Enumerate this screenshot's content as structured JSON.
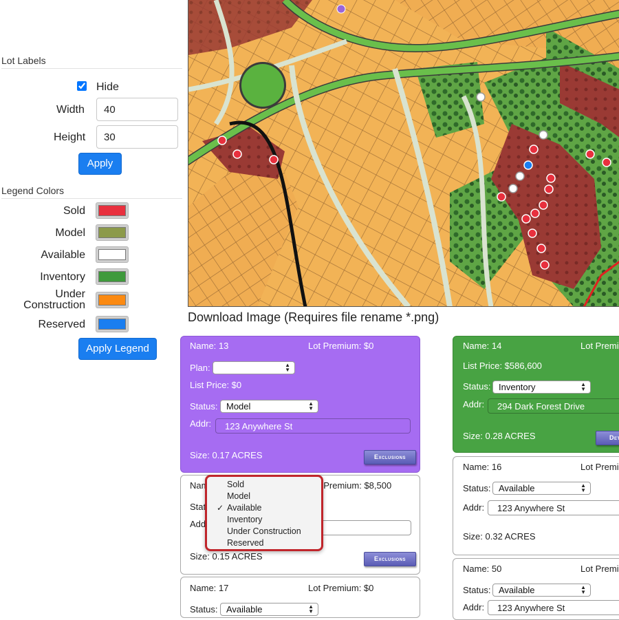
{
  "lot_labels": {
    "title": "Lot Labels",
    "hide_label": "Hide",
    "hide_checked": true,
    "width_label": "Width",
    "width_value": "40",
    "height_label": "Height",
    "height_value": "30",
    "apply_label": "Apply"
  },
  "legend": {
    "title": "Legend Colors",
    "items": [
      {
        "label": "Sold",
        "color": "#e8303e"
      },
      {
        "label": "Model",
        "color": "#8c9a4a"
      },
      {
        "label": "Available",
        "color": "#ffffff"
      },
      {
        "label": "Inventory",
        "color": "#3f9a3c"
      },
      {
        "label": "Under Construction",
        "label_line1": "Under",
        "label_line2": "Construction",
        "color": "#fb8a12"
      },
      {
        "label": "Reserved",
        "color": "#1a7ef0"
      }
    ],
    "apply_label": "Apply Legend"
  },
  "download_label": "Download Image (Requires file rename *.png)",
  "exclusions_label": "Exclusions",
  "details_label": "Deta",
  "cards": [
    {
      "name": "Name: 13",
      "premium": "Lot Premium: $0",
      "plan_label": "Plan:",
      "plan_value": "",
      "list_price": "List Price: $0",
      "status_label": "Status:",
      "status_value": "Model",
      "addr_label": "Addr:",
      "addr_value": "123 Anywhere St",
      "size": "Size: 0.17 ACRES"
    },
    {
      "name": "Name: 14",
      "premium": "Lot Premi",
      "list_price": "List Price: $586,600",
      "status_label": "Status:",
      "status_value": "Inventory",
      "addr_label": "Addr:",
      "addr_value": "294 Dark Forest Drive",
      "size": "Size: 0.28 ACRES"
    },
    {
      "name": "Name",
      "premium": "t Premium: $8,500",
      "status_label": "Status",
      "addr_label": "Addr:",
      "size": "Size: 0.15 ACRES"
    },
    {
      "name": "Name: 16",
      "premium": "Lot Premi",
      "status_label": "Status:",
      "status_value": "Available",
      "addr_label": "Addr:",
      "addr_value": "123 Anywhere St",
      "size": "Size: 0.32 ACRES"
    },
    {
      "name": "Name: 17",
      "premium": "Lot Premium: $0",
      "status_label": "Status:",
      "status_value": "Available"
    },
    {
      "name": "Name: 50",
      "premium": "Lot Premi",
      "status_label": "Status:",
      "status_value": "Available",
      "addr_label": "Addr:",
      "addr_value": "123 Anywhere St"
    }
  ],
  "status_dropdown": {
    "options": [
      "Sold",
      "Model",
      "Available",
      "Inventory",
      "Under Construction",
      "Reserved"
    ],
    "selected": "Available",
    "check_mark": "✓"
  }
}
